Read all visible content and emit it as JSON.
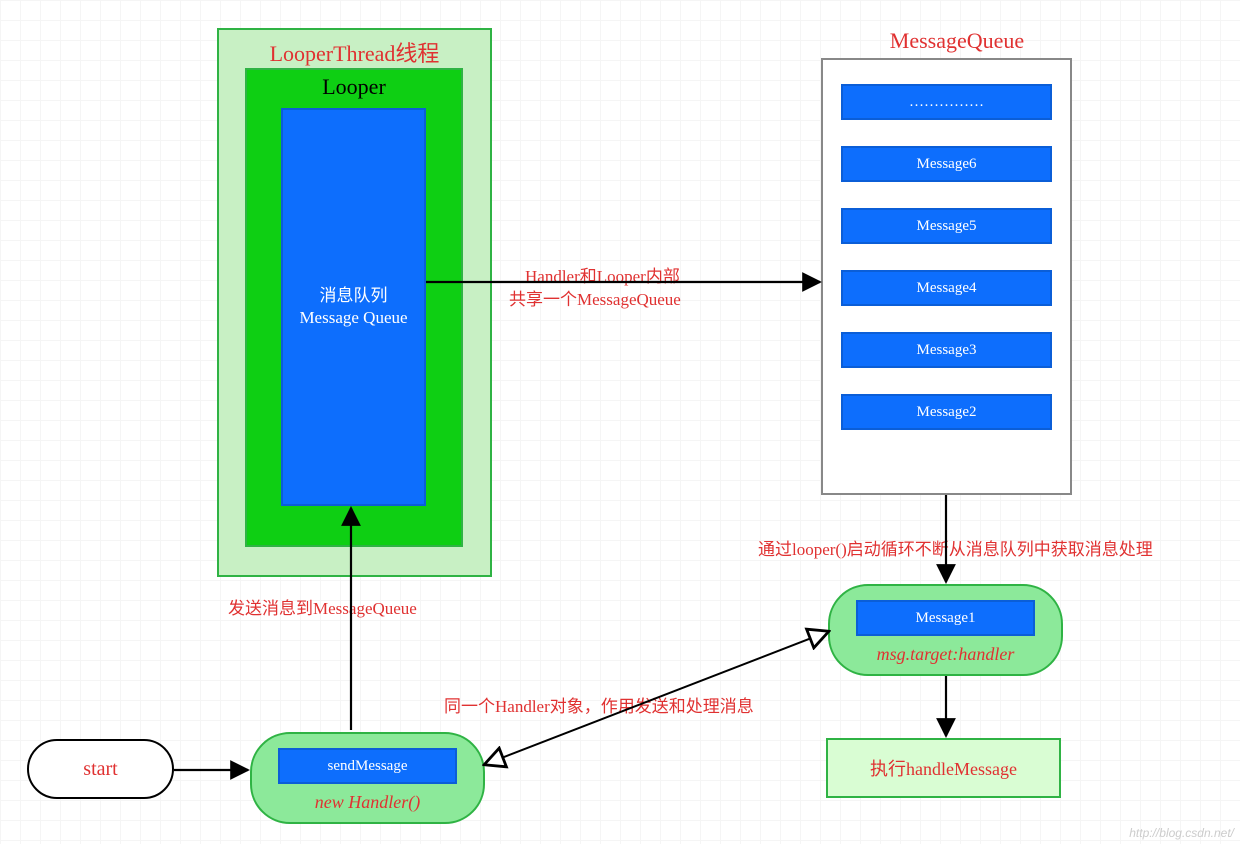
{
  "thread": {
    "title": "LooperThread线程"
  },
  "looper": {
    "title": "Looper",
    "inner1": "消息队列",
    "inner2": "Message Queue"
  },
  "mq": {
    "title": "MessageQueue",
    "items": [
      "……………",
      "Message6",
      "Message5",
      "Message4",
      "Message3",
      "Message2"
    ]
  },
  "labels": {
    "share1": "Handler和Looper内部",
    "share2": "共享一个MessageQueue",
    "send": "发送消息到MessageQueue",
    "loop": "通过looper()启动循环不断从消息队列中获取消息处理",
    "same": "同一个Handler对象，作用发送和处理消息"
  },
  "target": {
    "msg": "Message1",
    "tag": "msg.target:handler"
  },
  "handler": {
    "btn": "sendMessage",
    "title": "new Handler()"
  },
  "start": "start",
  "exec": "执行handleMessage",
  "watermark": "http://blog.csdn.net/"
}
